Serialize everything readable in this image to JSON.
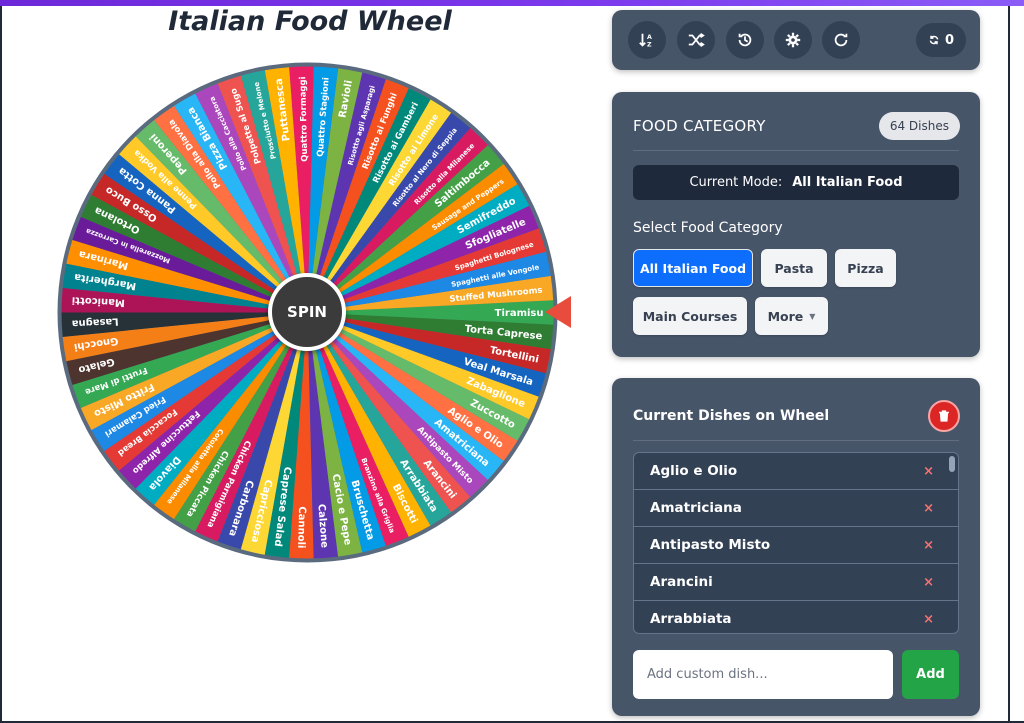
{
  "title": "Italian Food Wheel",
  "wheel": {
    "spin_label": "SPIN",
    "segments": [
      "Tiramisu",
      "Stuffed Mushrooms",
      "Spaghetti alle Vongole",
      "Spaghetti Bolognese",
      "Sfogliatelle",
      "Semifreddo",
      "Sausage and Peppers",
      "Saltimbocca",
      "Risotto alla Milanese",
      "Risotto al Nero di Seppia",
      "Risotto ai Limone",
      "Risotto ai Gamberi",
      "Risotto ai Funghi",
      "Risotto agli Asparagi",
      "Ravioli",
      "Quattro Stagioni",
      "Quattro Formaggi",
      "Puttanesca",
      "Prosciutto e Melone",
      "Polpette al Sugo",
      "Pollo alla Cacciatora",
      "Pizza Bianca",
      "Pollo alla Diavola",
      "Peperoni",
      "Penne alla Vodka",
      "Panna Cotta",
      "Osso Buco",
      "Ortolana",
      "Mozzarella in Carrozza",
      "Marinara",
      "Margherita",
      "Manicotti",
      "Lasagna",
      "Gnocchi",
      "Gelato",
      "Frutti di Mare",
      "Fritto Misto",
      "Fried Calamari",
      "Focaccia Bread",
      "Fettuccine Alfredo",
      "Diavola",
      "Cotoletta alla Milanese",
      "Chicken Piccata",
      "Chicken Parmigiana",
      "Carbonara",
      "Capricciosa",
      "Caprese Salad",
      "Cannoli",
      "Calzone",
      "Cacio e Pepe",
      "Bruschetta",
      "Branzino alla Griglia",
      "Biscotti",
      "Arrabbiata",
      "Arancini",
      "Antipasto Misto",
      "Amatriciana",
      "Aglio e Olio",
      "Zuccotto",
      "Zabaglione",
      "Veal Marsala",
      "Tortellini",
      "Torta Caprese"
    ],
    "colors": [
      "#34a853",
      "#f9a825",
      "#1e88e5",
      "#e53935",
      "#8e24aa",
      "#00acc1",
      "#fb8c00",
      "#43a047",
      "#d81b60",
      "#3949ab",
      "#fdd835",
      "#00897b",
      "#f4511e",
      "#5e35b1",
      "#7cb342",
      "#039be5",
      "#e91e63",
      "#ffb300",
      "#26a69a",
      "#ef5350",
      "#ab47bc",
      "#29b6f6",
      "#ff7043",
      "#66bb6a",
      "#ffca28",
      "#1565c0",
      "#c62828",
      "#2e7d32",
      "#6a1b9a",
      "#ff8f00",
      "#00838f",
      "#ad1457",
      "#263238",
      "#f57f17",
      "#4e342e"
    ]
  },
  "toolbar": {
    "buttons": [
      "sort-icon",
      "shuffle-icon",
      "history-icon",
      "settings-icon",
      "refresh-icon"
    ],
    "counter": "0"
  },
  "category": {
    "heading": "FOOD CATEGORY",
    "count_badge": "64 Dishes",
    "mode_label": "Current Mode:",
    "mode_value": "All Italian Food",
    "select_label": "Select Food Category",
    "buttons": [
      "All Italian Food",
      "Pasta",
      "Pizza",
      "Main Courses",
      "More"
    ],
    "active": "All Italian Food"
  },
  "dishes": {
    "heading": "Current Dishes on Wheel",
    "items": [
      "Aglio e Olio",
      "Amatriciana",
      "Antipasto Misto",
      "Arancini",
      "Arrabbiata"
    ],
    "remove_symbol": "×",
    "input_placeholder": "Add custom dish...",
    "add_label": "Add"
  }
}
